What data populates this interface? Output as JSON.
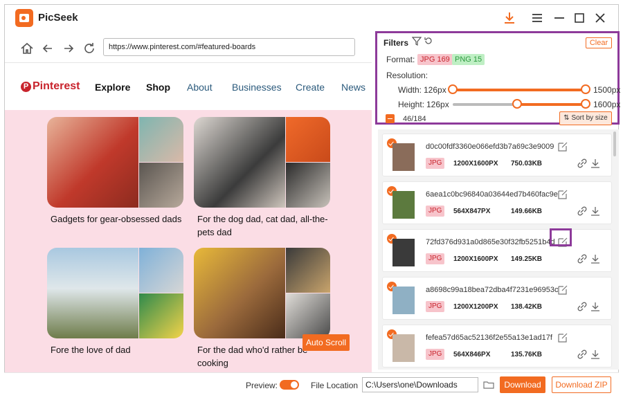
{
  "app": {
    "title": "PicSeek"
  },
  "browser": {
    "url": "https://www.pinterest.com/#featured-boards"
  },
  "pinterest": {
    "logo": "Pinterest",
    "nav": [
      "Explore",
      "Shop",
      "About",
      "Businesses",
      "Create",
      "News"
    ],
    "cards": [
      "Gadgets for gear-obsessed dads",
      "For the dog dad, cat dad, all-the-pets dad",
      "Fore the love of dad",
      "For the dad who'd rather be cooking"
    ],
    "auto_scroll": "Auto Scroll"
  },
  "filters": {
    "title": "Filters",
    "clear": "Clear",
    "format_label": "Format:",
    "formats": [
      {
        "label": "JPG 169",
        "color": "#c8232c"
      },
      {
        "label": "PNG 15",
        "color": "#2c9a3f"
      }
    ],
    "resolution_label": "Resolution:",
    "width_label": "Width:",
    "width_min": "126px",
    "width_max": "1500px",
    "width_range_fraction": [
      0.0,
      1.0
    ],
    "height_label": "Height:",
    "height_min": "126px",
    "height_max": "1600px",
    "height_range_fraction": [
      0.5,
      1.0
    ],
    "count": "46/184",
    "sort_label": "Sort by size"
  },
  "images": [
    {
      "name": "d0c00fdf3360e066efd3b7a69c3e9009",
      "format": "JPG",
      "dims": "1200X1600PX",
      "size": "750.03KB",
      "thumb_color": "#8a6c5a"
    },
    {
      "name": "6aea1c0bc96840a03644ed7b460fac9e",
      "format": "JPG",
      "dims": "564X847PX",
      "size": "149.66KB",
      "thumb_color": "#5c7a3e"
    },
    {
      "name": "72fd376d931a0d865e30f32fb5251b4d",
      "format": "JPG",
      "dims": "1200X1600PX",
      "size": "149.25KB",
      "thumb_color": "#3a3a3a"
    },
    {
      "name": "a8698c99a18bea72dba4f7231e96953c",
      "format": "JPG",
      "dims": "1200X1200PX",
      "size": "138.42KB",
      "thumb_color": "#8fb0c4"
    },
    {
      "name": "fefea57d65ac52136f2e55a13e1ad17f",
      "format": "JPG",
      "dims": "564X846PX",
      "size": "135.76KB",
      "thumb_color": "#c9b8a8"
    }
  ],
  "bottom": {
    "preview_label": "Preview:",
    "preview_on": true,
    "file_location_label": "File Location",
    "path": "C:\\Users\\one\\Downloads",
    "download": "Download",
    "download_zip": "Download ZIP"
  },
  "colors": {
    "accent": "#f26b21",
    "highlight": "#8d3a9a",
    "pin_bg": "#fbdde5"
  }
}
